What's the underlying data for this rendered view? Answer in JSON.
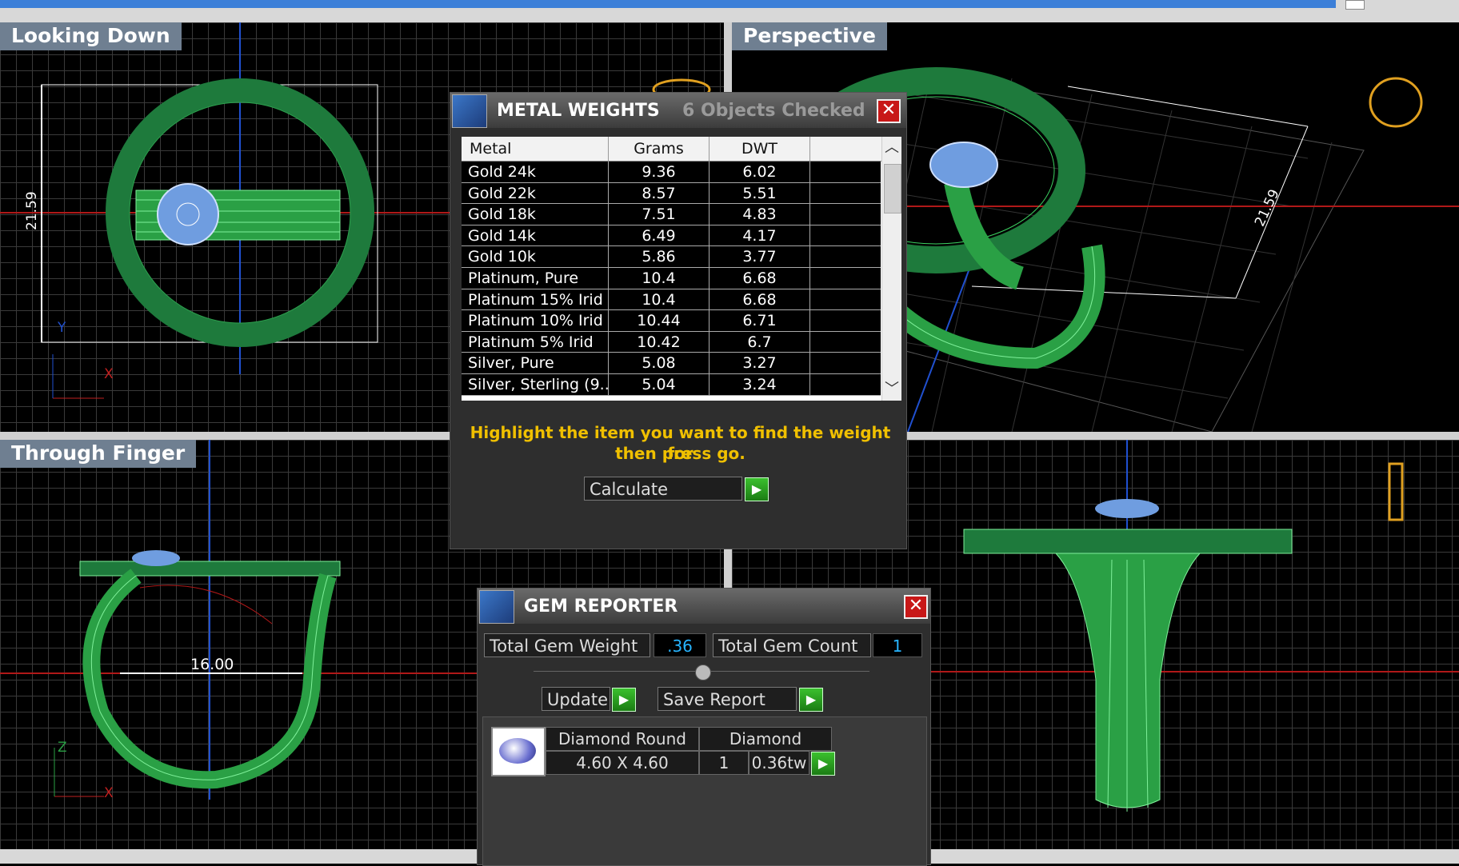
{
  "viewports": {
    "top_left": {
      "label": "Looking Down",
      "dimension": "21.59",
      "axis_x": "X",
      "axis_y": "Y"
    },
    "top_right": {
      "label": "Perspective",
      "dimension": "21.59"
    },
    "bottom_left": {
      "label": "Through Finger",
      "dimension": "16.00",
      "axis_x": "X",
      "axis_z": "Z"
    },
    "bottom_right": {
      "label": ""
    }
  },
  "metal_weights": {
    "title": "METAL WEIGHTS",
    "subtitle": "6 Objects Checked",
    "close": "✕",
    "columns": [
      "Metal",
      "Grams",
      "DWT"
    ],
    "rows": [
      {
        "metal": "Gold 24k",
        "grams": "9.36",
        "dwt": "6.02"
      },
      {
        "metal": "Gold 22k",
        "grams": "8.57",
        "dwt": "5.51"
      },
      {
        "metal": "Gold 18k",
        "grams": "7.51",
        "dwt": "4.83"
      },
      {
        "metal": "Gold 14k",
        "grams": "6.49",
        "dwt": "4.17"
      },
      {
        "metal": "Gold 10k",
        "grams": "5.86",
        "dwt": "3.77"
      },
      {
        "metal": "Platinum, Pure",
        "grams": "10.4",
        "dwt": "6.68"
      },
      {
        "metal": "Platinum 15% Irid",
        "grams": "10.4",
        "dwt": "6.68"
      },
      {
        "metal": "Platinum 10% Irid",
        "grams": "10.44",
        "dwt": "6.71"
      },
      {
        "metal": "Platinum 5% Irid",
        "grams": "10.42",
        "dwt": "6.7"
      },
      {
        "metal": "Silver, Pure",
        "grams": "5.08",
        "dwt": "3.27"
      },
      {
        "metal": "Silver, Sterling (9...",
        "grams": "5.04",
        "dwt": "3.24"
      }
    ],
    "hint_line1": "Highlight the item you want to find the weight for",
    "hint_line2": "then press go.",
    "calculate_label": "Calculate"
  },
  "gem_reporter": {
    "title": "GEM REPORTER",
    "close": "✕",
    "total_weight_label": "Total Gem Weight",
    "total_weight_value": ".36",
    "total_count_label": "Total Gem Count",
    "total_count_value": "1",
    "update_label": "Update",
    "save_report_label": "Save Report",
    "gem": {
      "shape": "Diamond Round",
      "type": "Diamond",
      "size": "4.60 X 4.60",
      "count": "1",
      "weight": "0.36tw"
    }
  }
}
